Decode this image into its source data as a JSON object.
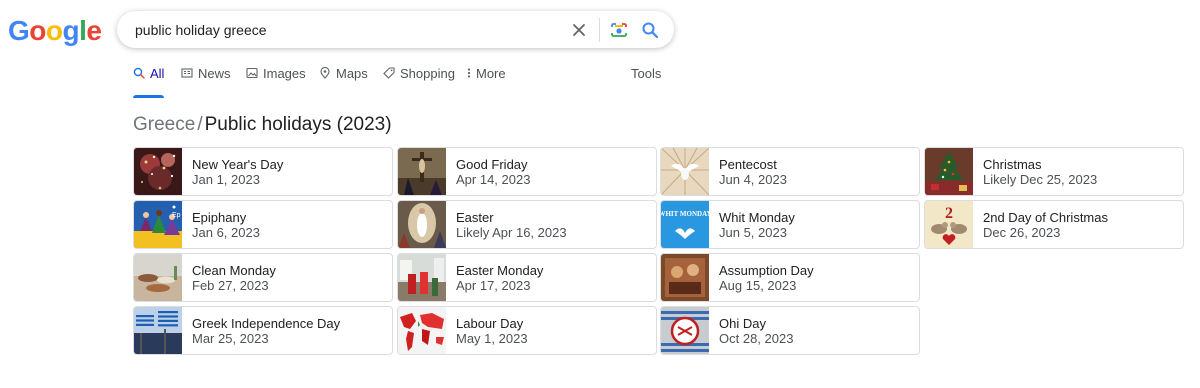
{
  "logo": {
    "letters": [
      "G",
      "o",
      "o",
      "g",
      "l",
      "e"
    ],
    "colors": [
      "#4285f4",
      "#ea4335",
      "#fbbc05",
      "#4285f4",
      "#34a853",
      "#ea4335"
    ],
    "text": "Google"
  },
  "search": {
    "query": "public holiday greece",
    "icons": [
      "clear-icon",
      "camera-icon",
      "search-icon"
    ]
  },
  "tabs": [
    {
      "label": "All",
      "icon": "search-icon",
      "active": true
    },
    {
      "label": "News",
      "icon": "news-icon"
    },
    {
      "label": "Images",
      "icon": "image-icon"
    },
    {
      "label": "Maps",
      "icon": "map-pin-icon"
    },
    {
      "label": "Shopping",
      "icon": "tag-icon"
    },
    {
      "label": "More",
      "icon": "more-dots-icon"
    },
    {
      "label": "Tools",
      "icon": ""
    }
  ],
  "breadcrumb": {
    "parent": "Greece",
    "separator": "/",
    "current": "Public holidays (2023)"
  },
  "holidays": [
    {
      "name": "New Year's Day",
      "date": "Jan 1, 2023",
      "thumb": "fireworks-thumbnail"
    },
    {
      "name": "Epiphany",
      "date": "Jan 6, 2023",
      "thumb": "three-kings-thumbnail"
    },
    {
      "name": "Clean Monday",
      "date": "Feb 27, 2023",
      "thumb": "table-food-thumbnail"
    },
    {
      "name": "Greek Independence Day",
      "date": "Mar 25, 2023",
      "thumb": "greek-flags-thumbnail"
    },
    {
      "name": "Good Friday",
      "date": "Apr 14, 2023",
      "thumb": "crucifixion-thumbnail"
    },
    {
      "name": "Easter",
      "date": "Likely Apr 16, 2023",
      "thumb": "resurrection-thumbnail"
    },
    {
      "name": "Easter Monday",
      "date": "Apr 17, 2023",
      "thumb": "procession-thumbnail"
    },
    {
      "name": "Labour Day",
      "date": "May 1, 2023",
      "thumb": "world-map-thumbnail"
    },
    {
      "name": "Pentecost",
      "date": "Jun 4, 2023",
      "thumb": "dove-thumbnail"
    },
    {
      "name": "Whit Monday",
      "date": "Jun 5, 2023",
      "thumb": "whit-monday-thumbnail",
      "thumb_text": "WHIT MONDAY"
    },
    {
      "name": "Assumption Day",
      "date": "Aug 15, 2023",
      "thumb": "icon-painting-thumbnail"
    },
    {
      "name": "Ohi Day",
      "date": "Oct 28, 2023",
      "thumb": "ohi-sign-thumbnail"
    },
    {
      "name": "Christmas",
      "date": "Likely Dec 25, 2023",
      "thumb": "christmas-tree-thumbnail"
    },
    {
      "name": "2nd Day of Christmas",
      "date": "Dec 26, 2023",
      "thumb": "turtle-doves-thumbnail",
      "thumb_text": "2"
    }
  ],
  "colors": {
    "accent": "#1a73e8",
    "active_tab": "#1a0dab",
    "border": "#dadce0",
    "muted": "#70757a"
  }
}
